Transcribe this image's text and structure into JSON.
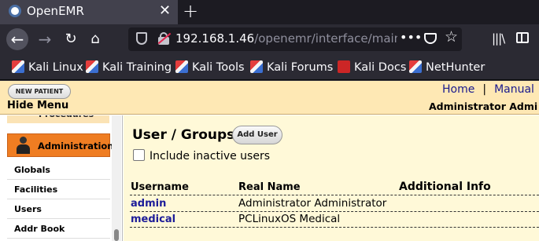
{
  "browser": {
    "tab_title": "OpenEMR",
    "tab_close": "✕",
    "new_tab": "+",
    "url_host": "192.168.1.46",
    "url_path": "/openemr/interface/main/m",
    "url_more": "•••",
    "bookmarks": [
      "Kali Linux",
      "Kali Training",
      "Kali Tools",
      "Kali Forums",
      "Kali Docs",
      "NetHunter"
    ]
  },
  "header": {
    "new_patient": "NEW PATIENT",
    "hide_menu": "Hide Menu",
    "home": "Home",
    "separator": "|",
    "manual": "Manual",
    "user_name": "Administrator Admi"
  },
  "menu": {
    "procedures": "Procedures",
    "administration": "Administration",
    "items": [
      "Globals",
      "Facilities",
      "Users",
      "Addr Book"
    ]
  },
  "main": {
    "title": "User / Groups",
    "add_user": "Add User",
    "include_inactive": "Include inactive users",
    "columns": [
      "Username",
      "Real Name",
      "Additional Info"
    ],
    "rows": [
      {
        "username": "admin",
        "real_name": "Administrator Administrator",
        "info": ""
      },
      {
        "username": "medical",
        "real_name": "PCLinuxOS Medical",
        "info": ""
      }
    ]
  }
}
